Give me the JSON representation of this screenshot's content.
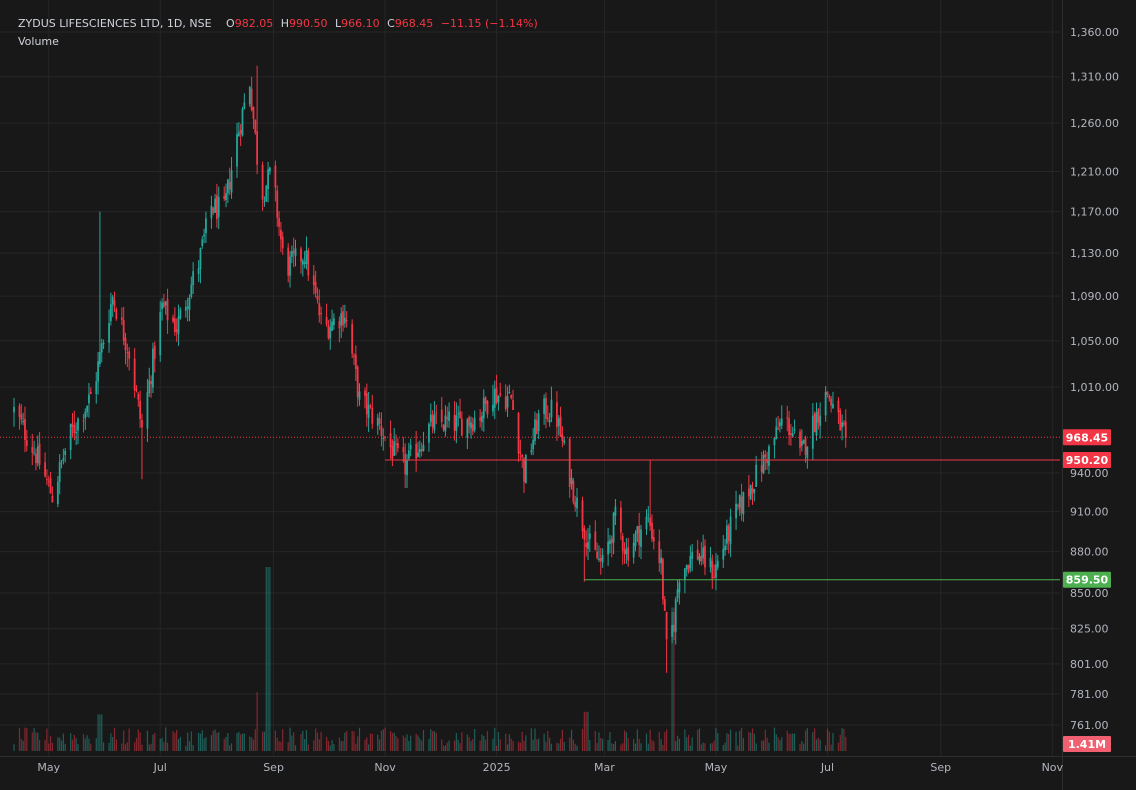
{
  "legend": {
    "symbol": "ZYDUS LIFESCIENCES LTD, 1D, NSE",
    "open_label": "O",
    "open": "982.05",
    "high_label": "H",
    "high": "990.50",
    "low_label": "L",
    "low": "966.10",
    "close_label": "C",
    "close": "968.45",
    "change": "−11.15 (−1.14%)",
    "volume_label": "Volume"
  },
  "colors": {
    "up": "#26a69a",
    "down": "#f23645",
    "support": "#4caf50",
    "resistance": "#f23645",
    "background": "#181818"
  },
  "chart_data": {
    "type": "candlestick",
    "symbol": "ZYDUS LIFESCIENCES LTD",
    "interval": "1D",
    "exchange": "NSE",
    "y_ticks": [
      1360,
      1310,
      1260,
      1210,
      1170,
      1130,
      1090,
      1050,
      1010,
      940,
      910,
      880,
      850,
      825,
      801,
      781,
      761
    ],
    "y_tick_labels": [
      "1,360.00",
      "1,310.00",
      "1,260.00",
      "1,210.00",
      "1,170.00",
      "1,130.00",
      "1,090.00",
      "1,050.00",
      "1,010.00",
      "940.00",
      "910.00",
      "880.00",
      "850.00",
      "825.00",
      "801.00",
      "781.00",
      "761.00"
    ],
    "scale": "log",
    "x_ticks": [
      "2024-05-01",
      "2024-07-01",
      "2024-09-01",
      "2024-11-01",
      "2025-01-01",
      "2025-03-01",
      "2025-05-01",
      "2025-07-01",
      "2025-09-01",
      "2025-11-01"
    ],
    "x_tick_labels": [
      "May",
      "Jul",
      "Sep",
      "Nov",
      "2025",
      "Mar",
      "May",
      "Jul",
      "Sep",
      "Nov"
    ],
    "first_date": "2024-04-12",
    "last_date": "2025-07-11",
    "price_labels": [
      {
        "value": 968.45,
        "text": "968.45",
        "kind": "last"
      },
      {
        "value": 950.2,
        "text": "950.20",
        "kind": "resistance"
      },
      {
        "value": 859.5,
        "text": "859.50",
        "kind": "support"
      }
    ],
    "horizontal_lines": [
      {
        "value": 950.2,
        "start": "2024-11-01",
        "end": "2025-11-01",
        "color": "#f23645"
      },
      {
        "value": 859.5,
        "start": "2025-02-18",
        "end": "2025-11-01",
        "color": "#4caf50"
      }
    ],
    "volume_label": "1.41M",
    "volume_max": 1.41,
    "volume_last": 0.05,
    "close_path": [
      [
        "2024-04-12",
        990
      ],
      [
        "2024-04-24",
        955
      ],
      [
        "2024-05-03",
        922
      ],
      [
        "2024-05-12",
        968
      ],
      [
        "2024-05-25",
        1005
      ],
      [
        "2024-06-05",
        1090
      ],
      [
        "2024-06-14",
        1040
      ],
      [
        "2024-06-21",
        975
      ],
      [
        "2024-07-02",
        1080
      ],
      [
        "2024-07-10",
        1062
      ],
      [
        "2024-07-22",
        1120
      ],
      [
        "2024-07-29",
        1175
      ],
      [
        "2024-08-05",
        1170
      ],
      [
        "2024-08-12",
        1245
      ],
      [
        "2024-08-19",
        1305
      ],
      [
        "2024-08-25",
        1185
      ],
      [
        "2024-08-31",
        1210
      ],
      [
        "2024-09-07",
        1115
      ],
      [
        "2024-09-18",
        1130
      ],
      [
        "2024-09-28",
        1060
      ],
      [
        "2024-10-10",
        1075
      ],
      [
        "2024-10-18",
        1000
      ],
      [
        "2024-10-28",
        980
      ],
      [
        "2024-11-06",
        955
      ],
      [
        "2024-11-12",
        945
      ],
      [
        "2024-11-27",
        980
      ],
      [
        "2024-12-12",
        980
      ],
      [
        "2024-12-22",
        985
      ],
      [
        "2024-12-30",
        1005
      ],
      [
        "2025-01-09",
        1000
      ],
      [
        "2025-01-16",
        940
      ],
      [
        "2025-01-25",
        990
      ],
      [
        "2025-02-02",
        990
      ],
      [
        "2025-02-08",
        950
      ],
      [
        "2025-02-15",
        910
      ],
      [
        "2025-02-22",
        880
      ],
      [
        "2025-02-28",
        870
      ],
      [
        "2025-03-07",
        905
      ],
      [
        "2025-03-13",
        880
      ],
      [
        "2025-03-25",
        905
      ],
      [
        "2025-04-01",
        870
      ],
      [
        "2025-04-04",
        810
      ],
      [
        "2025-04-08",
        830
      ],
      [
        "2025-04-11",
        865
      ],
      [
        "2025-04-20",
        880
      ],
      [
        "2025-04-30",
        865
      ],
      [
        "2025-05-11",
        905
      ],
      [
        "2025-05-22",
        935
      ],
      [
        "2025-05-31",
        960
      ],
      [
        "2025-06-07",
        985
      ],
      [
        "2025-06-12",
        972
      ],
      [
        "2025-06-16",
        953
      ],
      [
        "2025-06-26",
        990
      ],
      [
        "2025-07-01",
        1005
      ],
      [
        "2025-07-06",
        985
      ],
      [
        "2025-07-11",
        968.45
      ]
    ],
    "volume_spikes": [
      {
        "date": "2024-08-29",
        "value": 1.41
      },
      {
        "date": "2025-04-07",
        "value": 1.1
      },
      {
        "date": "2024-08-24",
        "value": 0.45
      },
      {
        "date": "2025-02-19",
        "value": 0.3
      },
      {
        "date": "2024-05-29",
        "value": 0.28
      }
    ]
  }
}
